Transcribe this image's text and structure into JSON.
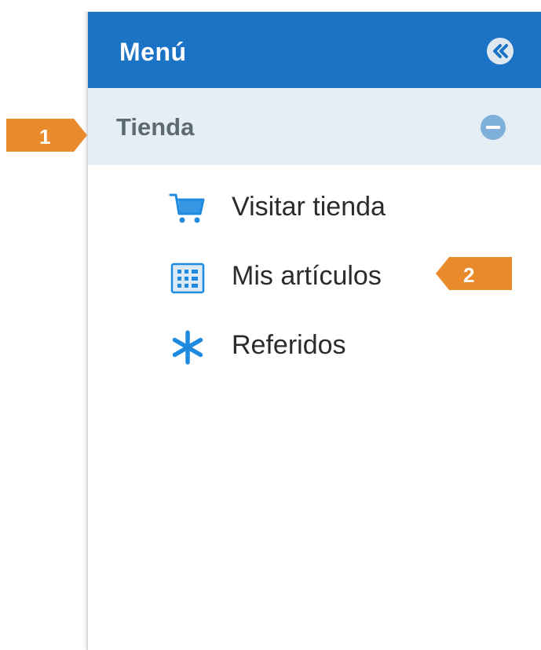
{
  "menu": {
    "title": "Menú",
    "collapse_icon": "double-chevron-left-icon"
  },
  "section": {
    "title": "Tienda",
    "toggle_icon": "minus-circle-icon"
  },
  "items": [
    {
      "label": "Visitar tienda",
      "icon": "cart-icon"
    },
    {
      "label": "Mis artículos",
      "icon": "grid-list-icon"
    },
    {
      "label": "Referidos",
      "icon": "asterisk-icon"
    }
  ],
  "callouts": [
    {
      "label": "1"
    },
    {
      "label": "2"
    }
  ],
  "colors": {
    "header_bg": "#1a73c5",
    "section_bg": "#e5edf5",
    "callout": "#e98a2c",
    "icon_blue": "#1f8be0"
  }
}
